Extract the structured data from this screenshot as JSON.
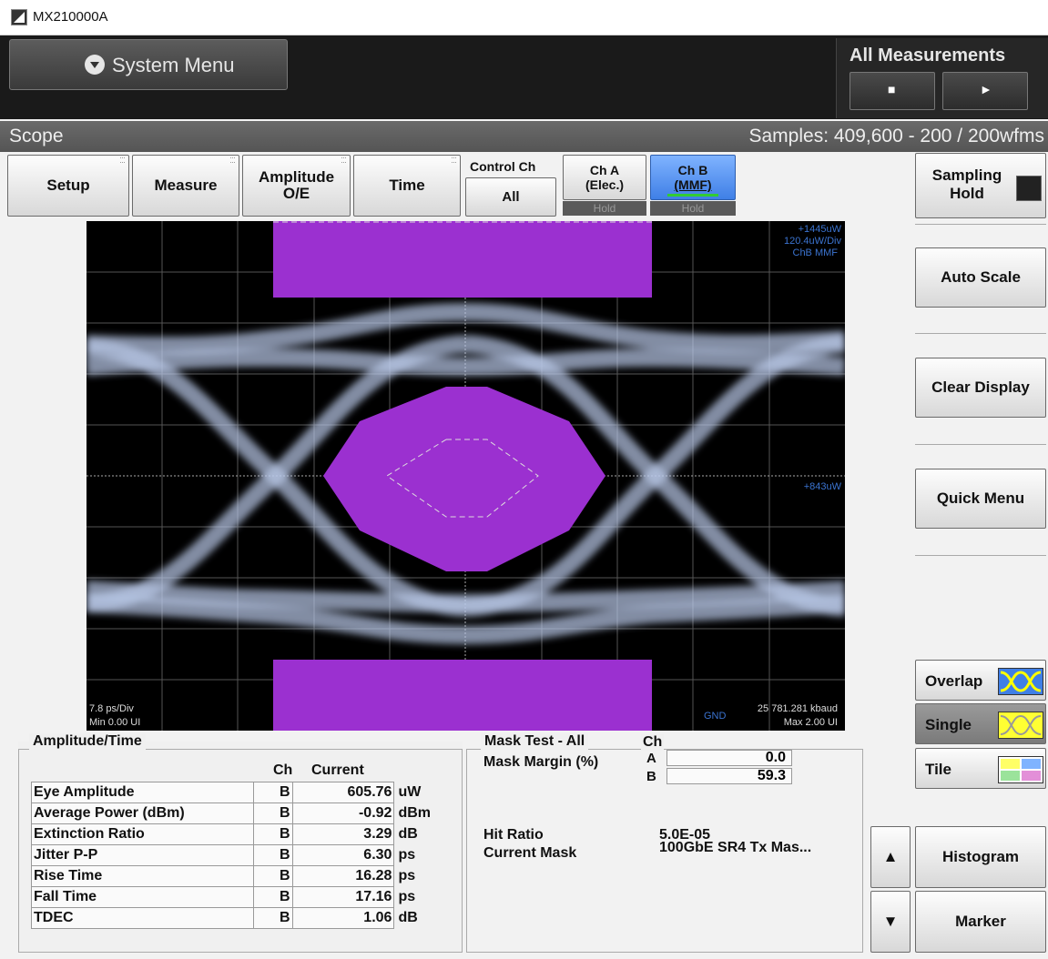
{
  "app": {
    "title": "MX210000A"
  },
  "top": {
    "system_menu": "System Menu",
    "all_measurements": "All Measurements",
    "stop_symbol": "■",
    "run_symbol": "►"
  },
  "scope": {
    "title": "Scope",
    "samples": "Samples: 409,600 - 200 / 200wfms"
  },
  "toolbar": {
    "setup": "Setup",
    "measure": "Measure",
    "amplitude_l1": "Amplitude",
    "amplitude_l2": "O/E",
    "time": "Time",
    "control_ch": "Control Ch",
    "control_ch_value": "All",
    "ch_a_l1": "Ch A",
    "ch_a_l2": "(Elec.)",
    "ch_a_hold": "Hold",
    "ch_b_l1": "Ch B",
    "ch_b_l2": "(MMF)",
    "ch_b_hold": "Hold"
  },
  "plot": {
    "top_right_1": "+1445uW",
    "top_right_2": "120.4uW/Div",
    "top_right_3": "ChB  MMF",
    "mid_right": "+843uW",
    "bottom_left_1": "7.8 ps/Div",
    "bottom_left_2": "Min 0.00 UI",
    "bottom_right_1": "25 781.281 kbaud",
    "bottom_right_2": "Max 2.00 UI",
    "gnd": "GND"
  },
  "right": {
    "sampling_l1": "Sampling",
    "sampling_l2": "Hold",
    "auto_scale": "Auto Scale",
    "clear_display": "Clear Display",
    "quick_menu": "Quick Menu",
    "overlap": "Overlap",
    "single": "Single",
    "tile": "Tile",
    "histogram": "Histogram",
    "marker": "Marker",
    "up": "▲",
    "down": "▼"
  },
  "amp_time": {
    "title": "Amplitude/Time",
    "col_ch": "Ch",
    "col_current": "Current",
    "rows": [
      {
        "name": "Eye Amplitude",
        "ch": "B",
        "value": "605.76",
        "unit": "uW"
      },
      {
        "name": "Average Power (dBm)",
        "ch": "B",
        "value": "-0.92",
        "unit": "dBm"
      },
      {
        "name": "Extinction Ratio",
        "ch": "B",
        "value": "3.29",
        "unit": "dB"
      },
      {
        "name": "Jitter P-P",
        "ch": "B",
        "value": "6.30",
        "unit": "ps"
      },
      {
        "name": "Rise Time",
        "ch": "B",
        "value": "16.28",
        "unit": "ps"
      },
      {
        "name": "Fall Time",
        "ch": "B",
        "value": "17.16",
        "unit": "ps"
      },
      {
        "name": "TDEC",
        "ch": "B",
        "value": "1.06",
        "unit": "dB"
      }
    ]
  },
  "mask": {
    "title": "Mask Test - All",
    "col_ch": "Ch",
    "margin_label": "Mask Margin (%)",
    "rows": [
      {
        "ch": "A",
        "value": "0.0"
      },
      {
        "ch": "B",
        "value": "59.3"
      }
    ],
    "hit_ratio_label": "Hit Ratio",
    "hit_ratio_value": "5.0E-05",
    "current_mask_label": "Current Mask",
    "current_mask_value": "100GbE SR4 Tx Mas..."
  }
}
